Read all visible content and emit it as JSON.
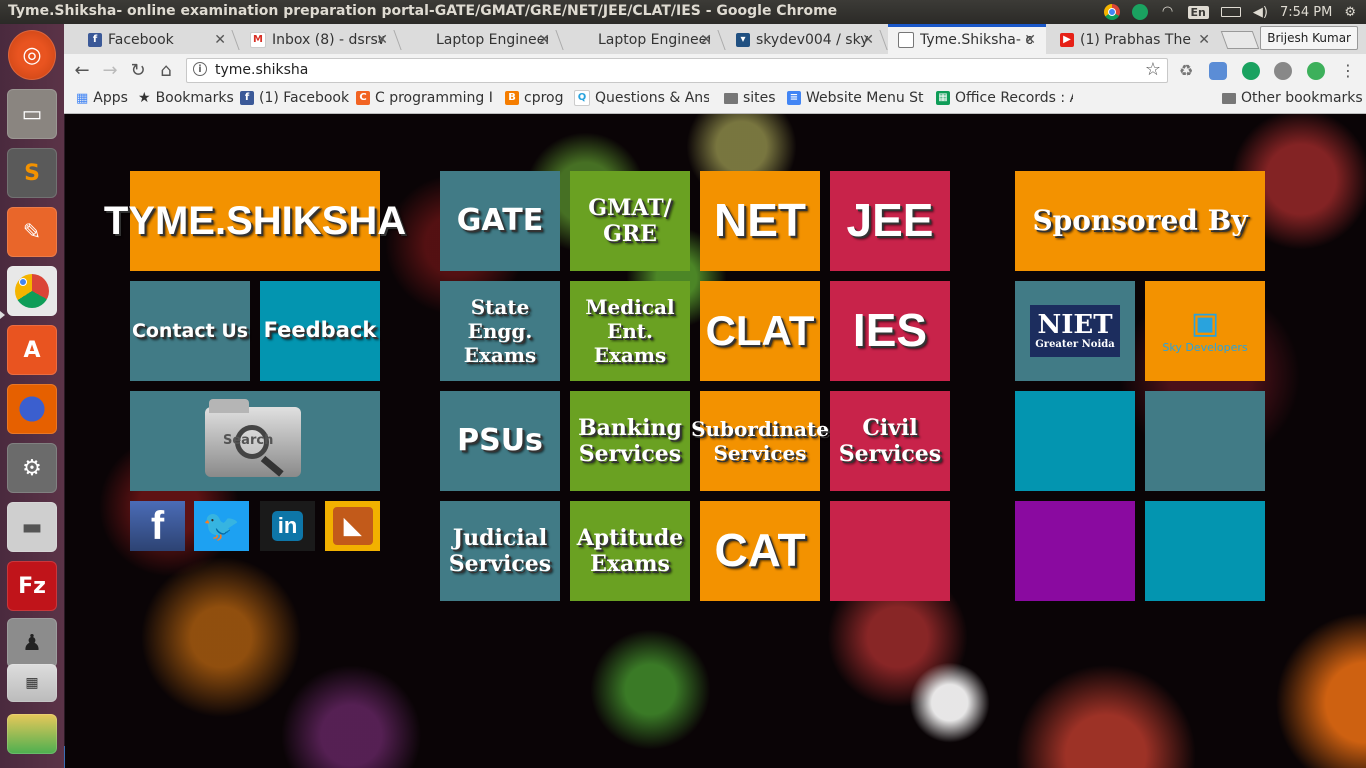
{
  "window": {
    "title": "Tyme.Shiksha- online examination preparation portal-GATE/GMAT/GRE/NET/JEE/CLAT/IES - Google Chrome"
  },
  "system_tray": {
    "language": "En",
    "time": "7:54 PM"
  },
  "tabs": [
    {
      "label": "Facebook",
      "favicon": "facebook-icon",
      "color": "#3b5998"
    },
    {
      "label": "Inbox (8) - dsrsw",
      "favicon": "gmail-icon",
      "color": "#d93025"
    },
    {
      "label": "Laptop Engineer",
      "favicon": "none",
      "color": ""
    },
    {
      "label": "Laptop Engineer",
      "favicon": "none",
      "color": ""
    },
    {
      "label": "skydev004 / sky",
      "favicon": "bitbucket-icon",
      "color": "#205081"
    },
    {
      "label": "Tyme.Shiksha- o",
      "favicon": "page-icon",
      "color": "#777777",
      "active": true
    },
    {
      "label": "(1) Prabhas The",
      "favicon": "youtube-icon",
      "color": "#e62117"
    }
  ],
  "profile": "Brijesh Kumar",
  "toolbar": {
    "url": "tyme.shiksha"
  },
  "bookmarks": [
    {
      "label": "Apps",
      "icon": "apps-grid-icon"
    },
    {
      "label": "Bookmarks",
      "icon": "star-icon"
    },
    {
      "label": "(1) Facebook",
      "icon": "facebook-icon"
    },
    {
      "label": "C programming In",
      "icon": "c-icon"
    },
    {
      "label": "cprog",
      "icon": "blogger-icon"
    },
    {
      "label": "Questions & Answ",
      "icon": "q-icon"
    },
    {
      "label": "sites",
      "icon": "folder-icon"
    },
    {
      "label": "Website Menu Str",
      "icon": "docs-icon"
    },
    {
      "label": "Office Records : A",
      "icon": "sheets-icon"
    },
    {
      "label": "Other bookmarks",
      "icon": "folder-icon"
    }
  ],
  "site": {
    "logo_text": "TYME.SHIKSHA",
    "contact": "Contact Us",
    "feedback": "Feedback",
    "search_image_alt": "Search",
    "sponsored_by": "Sponsored By",
    "sponsors": [
      "NIET",
      "Greater Noida",
      "Sky Developers"
    ],
    "exams": [
      [
        "GATE",
        ""
      ],
      [
        "GMAT/",
        "GRE"
      ],
      [
        "NET",
        ""
      ],
      [
        "JEE",
        ""
      ],
      [
        "State Engg.",
        "Exams"
      ],
      [
        "Medical Ent.",
        "Exams"
      ],
      [
        "CLAT",
        ""
      ],
      [
        "IES",
        ""
      ],
      [
        "PSUs",
        ""
      ],
      [
        "Banking",
        "Services"
      ],
      [
        "Subordinate",
        "Services"
      ],
      [
        "Civil",
        "Services"
      ],
      [
        "Judicial",
        "Services"
      ],
      [
        "Aptitude",
        "Exams"
      ],
      [
        "CAT",
        ""
      ],
      [
        "",
        ""
      ]
    ],
    "colors": {
      "orange": "#f39200",
      "teal": "#417b86",
      "green": "#6aa122",
      "red": "#c8234a",
      "cyan": "#0395b0",
      "purple": "#8a0aa0"
    }
  }
}
